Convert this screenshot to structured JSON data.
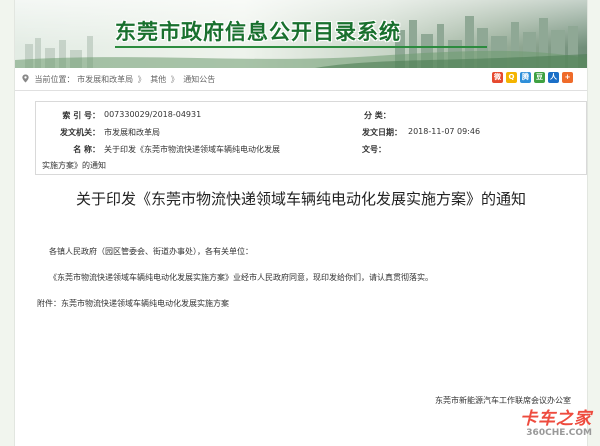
{
  "site": {
    "title": "东莞市政府信息公开目录系统"
  },
  "breadcrumb": {
    "prefix": "当前位置：",
    "items": [
      "市发展和改革局",
      "其他",
      "通知公告"
    ],
    "separator": "》"
  },
  "share_icons": [
    {
      "name": "weibo-share-icon",
      "glyph": "微",
      "color": "#e6492f"
    },
    {
      "name": "qzone-share-icon",
      "glyph": "Q",
      "color": "#f4b400"
    },
    {
      "name": "tencent-weibo-share-icon",
      "glyph": "腾",
      "color": "#2f8fd9"
    },
    {
      "name": "douban-share-icon",
      "glyph": "豆",
      "color": "#3fa142"
    },
    {
      "name": "renren-share-icon",
      "glyph": "人",
      "color": "#1b6fc7"
    },
    {
      "name": "more-share-icon",
      "glyph": "+",
      "color": "#ef6b2a"
    }
  ],
  "meta": {
    "index_label": "索  引  号：",
    "index_value": "007330029/2018-04931",
    "category_label": "分      类：",
    "category_value": "",
    "agency_label": "发文机关：",
    "agency_value": "市发展和改革局",
    "date_label": "发文日期：",
    "date_value": "2018-11-07 09:46",
    "subject_label": "名      称：",
    "subject_value_line1": "关于印发《东莞市物流快递领域车辆纯电动化发展",
    "subject_value_line2": "实施方案》的通知",
    "docno_label": "文号：",
    "docno_value": ""
  },
  "document": {
    "title": "关于印发《东莞市物流快递领域车辆纯电动化发展实施方案》的通知",
    "salutation": "各镇人民政府（园区管委会、街道办事处），各有关单位：",
    "paragraph": "《东莞市物流快递领域车辆纯电动化发展实施方案》业经市人民政府同意，现印发给你们，请认真贯彻落实。",
    "attachment": "附件：东莞市物流快递领域车辆纯电动化发展实施方案",
    "issuer": "东莞市新能源汽车工作联席会议办公室"
  },
  "watermark": {
    "main": "卡车之家",
    "sub": "360CHE.COM"
  }
}
